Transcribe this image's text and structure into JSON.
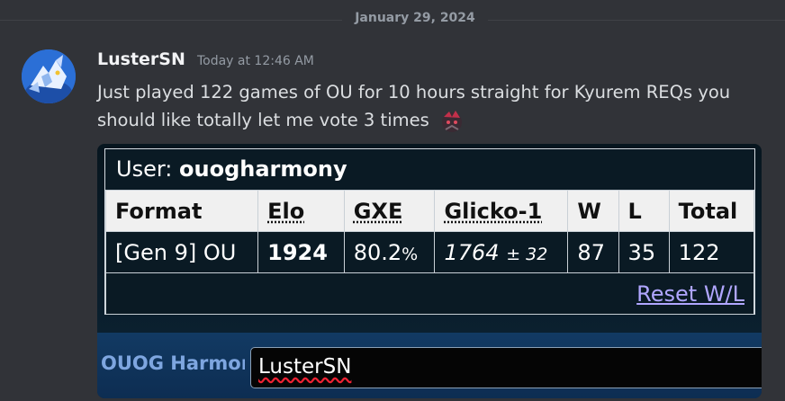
{
  "date_divider": "January 29, 2024",
  "message": {
    "author": "LusterSN",
    "timestamp": "Today at 12:46 AM",
    "text": "Just played 122 games of OU for 10 hours straight for Kyurem REQs you should like totally let me vote 3 times",
    "emoji": "custom-emoji"
  },
  "attachment": {
    "user_label": "User:",
    "user_name": "ouogharmony",
    "headers": [
      "Format",
      "Elo",
      "GXE",
      "Glicko-1",
      "W",
      "L",
      "Total"
    ],
    "row": {
      "format": "[Gen 9] OU",
      "elo": "1924",
      "gxe_value": "80.2",
      "gxe_unit": "%",
      "glicko_rating": "1764",
      "glicko_dev": "± 32",
      "w": "87",
      "l": "35",
      "total": "122"
    },
    "reset_link": "Reset W/L",
    "name_label": "OUOG Harmony",
    "name_input_value": "LusterSN"
  },
  "colors": {
    "background": "#313338",
    "username": "#f2f3f5",
    "link": "#b0a6ff"
  }
}
